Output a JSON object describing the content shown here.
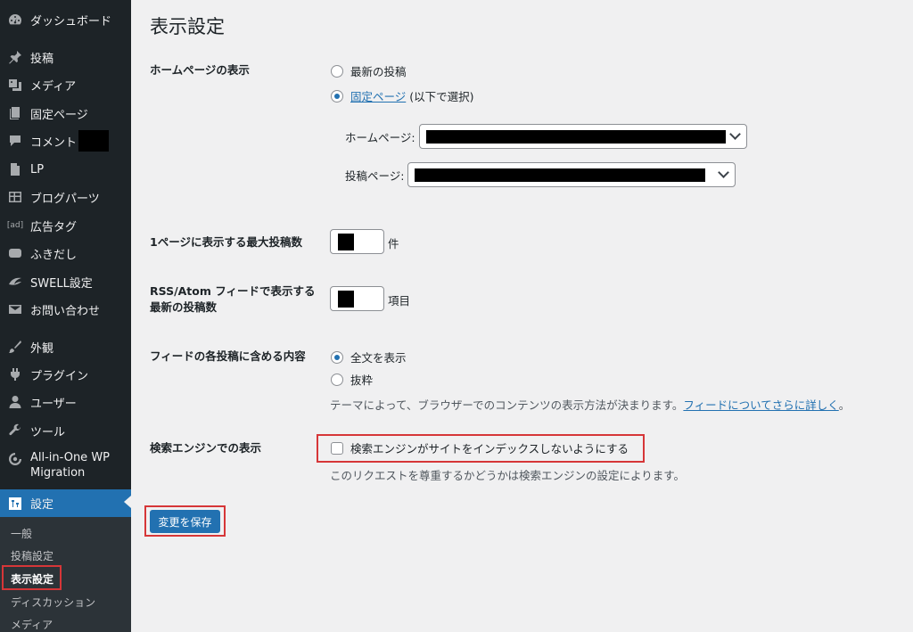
{
  "sidebar": {
    "items": [
      {
        "label": "ダッシュボード",
        "icon": "dashboard-icon"
      },
      {
        "label": "投稿",
        "icon": "pin-icon"
      },
      {
        "label": "メディア",
        "icon": "media-icon"
      },
      {
        "label": "固定ページ",
        "icon": "page-icon"
      },
      {
        "label": "コメント",
        "icon": "comment-icon"
      },
      {
        "label": "LP",
        "icon": "document-icon"
      },
      {
        "label": "ブログパーツ",
        "icon": "layout-icon"
      },
      {
        "label": "広告タグ",
        "icon": "ad-icon"
      },
      {
        "label": "ふきだし",
        "icon": "speech-bubble-icon"
      },
      {
        "label": "SWELL設定",
        "icon": "swell-icon"
      },
      {
        "label": "お問い合わせ",
        "icon": "mail-icon"
      },
      {
        "label": "外観",
        "icon": "brush-icon"
      },
      {
        "label": "プラグイン",
        "icon": "plugin-icon"
      },
      {
        "label": "ユーザー",
        "icon": "user-icon"
      },
      {
        "label": "ツール",
        "icon": "wrench-icon"
      },
      {
        "label": "All-in-One WP",
        "label2": "Migration",
        "icon": "migration-icon"
      },
      {
        "label": "設定",
        "icon": "settings-icon"
      }
    ],
    "ad_icon_text": "[ad]",
    "submenu": [
      "一般",
      "投稿設定",
      "表示設定",
      "ディスカッション",
      "メディア"
    ]
  },
  "main": {
    "title": "表示設定",
    "homepage_display": {
      "label": "ホームページの表示",
      "option_latest": "最新の投稿",
      "option_static_link": "固定ページ",
      "option_static_suffix": " (以下で選択)",
      "homepage_label": "ホームページ:",
      "posts_page_label": "投稿ページ:"
    },
    "posts_per_page": {
      "label": "1ページに表示する最大投稿数",
      "unit": "件"
    },
    "rss_posts": {
      "label_line1": "RSS/Atom フィードで表示する",
      "label_line2": "最新の投稿数",
      "unit": "項目"
    },
    "feed_content": {
      "label": "フィードの各投稿に含める内容",
      "option_full": "全文を表示",
      "option_excerpt": "抜粋",
      "desc_prefix": "テーマによって、ブラウザーでのコンテンツの表示方法が決まります。",
      "desc_link": "フィードについてさらに詳しく",
      "desc_suffix": "。"
    },
    "search_engine": {
      "label": "検索エンジンでの表示",
      "checkbox_label": "検索エンジンがサイトをインデックスしないようにする",
      "desc": "このリクエストを尊重するかどうかは検索エンジンの設定によります。"
    },
    "save_button": "変更を保存"
  },
  "colors": {
    "accent": "#2271b1",
    "sidebar_bg": "#1d2327",
    "highlight": "#d63638"
  }
}
